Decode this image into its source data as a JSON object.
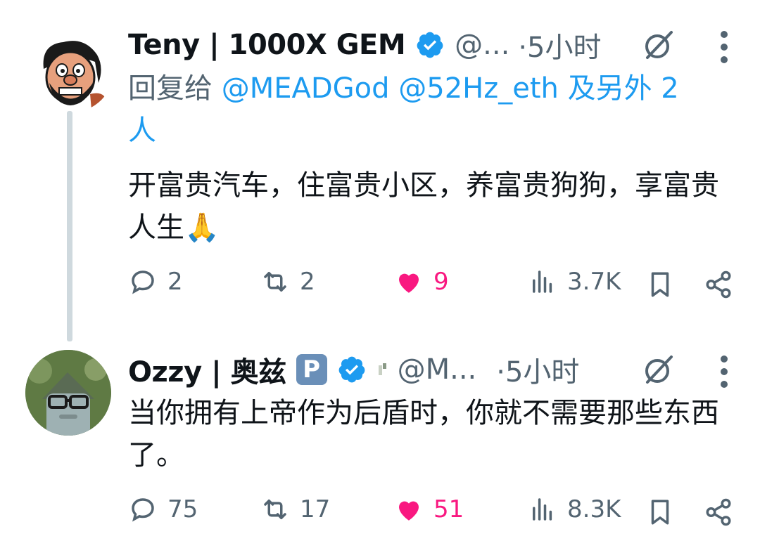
{
  "tweets": [
    {
      "author_name": "Teny | 1000X GEM",
      "handle": "@...",
      "time": "·5小时",
      "reply_prefix": "回复给",
      "reply_mentions": "@MEADGod @52Hz_eth 及另外 2",
      "reply_tail": "人",
      "text": "开富贵汽车，住富贵小区，养富贵狗狗，享富贵人生🙏",
      "replies": "2",
      "reposts": "2",
      "likes": "9",
      "views": "3.7K"
    },
    {
      "author_name": "Ozzy | 奥兹",
      "badge": "P",
      "handle": "@M...",
      "time": "·5小时",
      "text": "当你拥有上帝作为后盾时，你就不需要那些东西了。",
      "replies": "75",
      "reposts": "17",
      "likes": "51",
      "views": "8.3K"
    }
  ],
  "colors": {
    "accent": "#1d9bf0",
    "like": "#f91880",
    "secondary": "#536471"
  }
}
